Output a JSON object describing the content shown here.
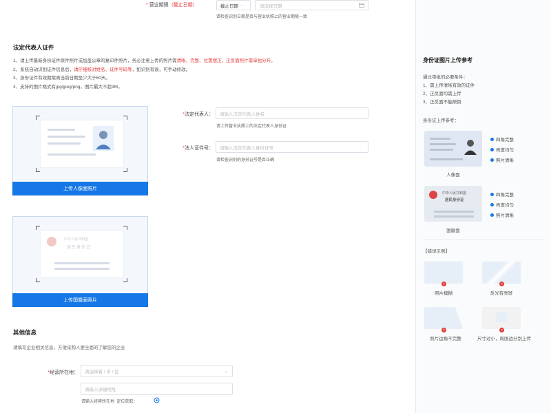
{
  "top": {
    "required_mark": "*",
    "label": "营业期限",
    "label_note": "（截止日期）",
    "select_value": "截止日期",
    "date_placeholder": "请选择日期",
    "hint": "请检查识别日期是否与营业执照上的营业期限一致"
  },
  "legal": {
    "title": "法定代表人证件",
    "rules": [
      {
        "text": "1、请上传最新身份证件原件照片或加盖公章的复印件照片，务必注意上传的照片需",
        "highlight": "清晰、完整、位置摆正，正反面照片需单独分开。"
      },
      {
        "text": "2、系统自动识别证件信息后，",
        "highlight": "请仔细核对姓名、证件号码等",
        "tail": "，如识别有误，可手动修改。"
      },
      {
        "text": "3、身份证件有效期需离当前日期至少大于60天。",
        "highlight": ""
      },
      {
        "text": "4、支持的图片格式有jpg/jpeg/png，图片最大不超3M。",
        "highlight": ""
      }
    ],
    "front_button": "上传人像面照片",
    "back_button": "上传国徽面照片",
    "back_card_text": "中华人民共和国",
    "back_card_text2": "居民身份证",
    "rep_label": "法定代表人：",
    "rep_placeholder": "请输入法定代表人姓名",
    "rep_hint": "请上传营业执照上的法定代表人身份证",
    "id_label": "法人证件号：",
    "id_placeholder": "请输入法定代表人身份证号",
    "id_hint": "请检查识别的身份证号是否正确",
    "required_mark": "*"
  },
  "other": {
    "title": "其他信息",
    "desc": "请填写企业相关信息，方便采购人更全面的了解您的企业",
    "loc_label": "经营所在地：",
    "loc_placeholder": "请选择省 / 市 / 区",
    "addr_placeholder": "请输入详细地址",
    "addr_hint": "请输入经营所在地",
    "locate_text": "定位获取：",
    "required_mark": "*"
  },
  "side": {
    "title": "身份证图片上传参考",
    "conditions_title": "通过审批的必要条件：",
    "conditions": [
      "1、需上传清晰有效的证件",
      "2、正反面均需上传",
      "3、正反面不能颠倒"
    ],
    "ref_title": "身份证上传参考：",
    "front_checks": [
      "四角完整",
      "亮度均匀",
      "照片清晰"
    ],
    "front_caption": "人像面",
    "back_checks": [
      "四角完整",
      "亮度均匀",
      "照片清晰"
    ],
    "back_caption": "国徽面",
    "back_thumb_text1": "中华人民共和国",
    "back_thumb_text2": "居民身份证",
    "error_title": "【错误示例】",
    "errors": [
      "照片模糊",
      "反光有亮斑",
      "照片边角不完整",
      "尺寸过小，周围边分别上传"
    ]
  },
  "colors": {
    "accent": "#1677e6",
    "required": "#e23c3c",
    "highlight": "#e23c3c"
  }
}
